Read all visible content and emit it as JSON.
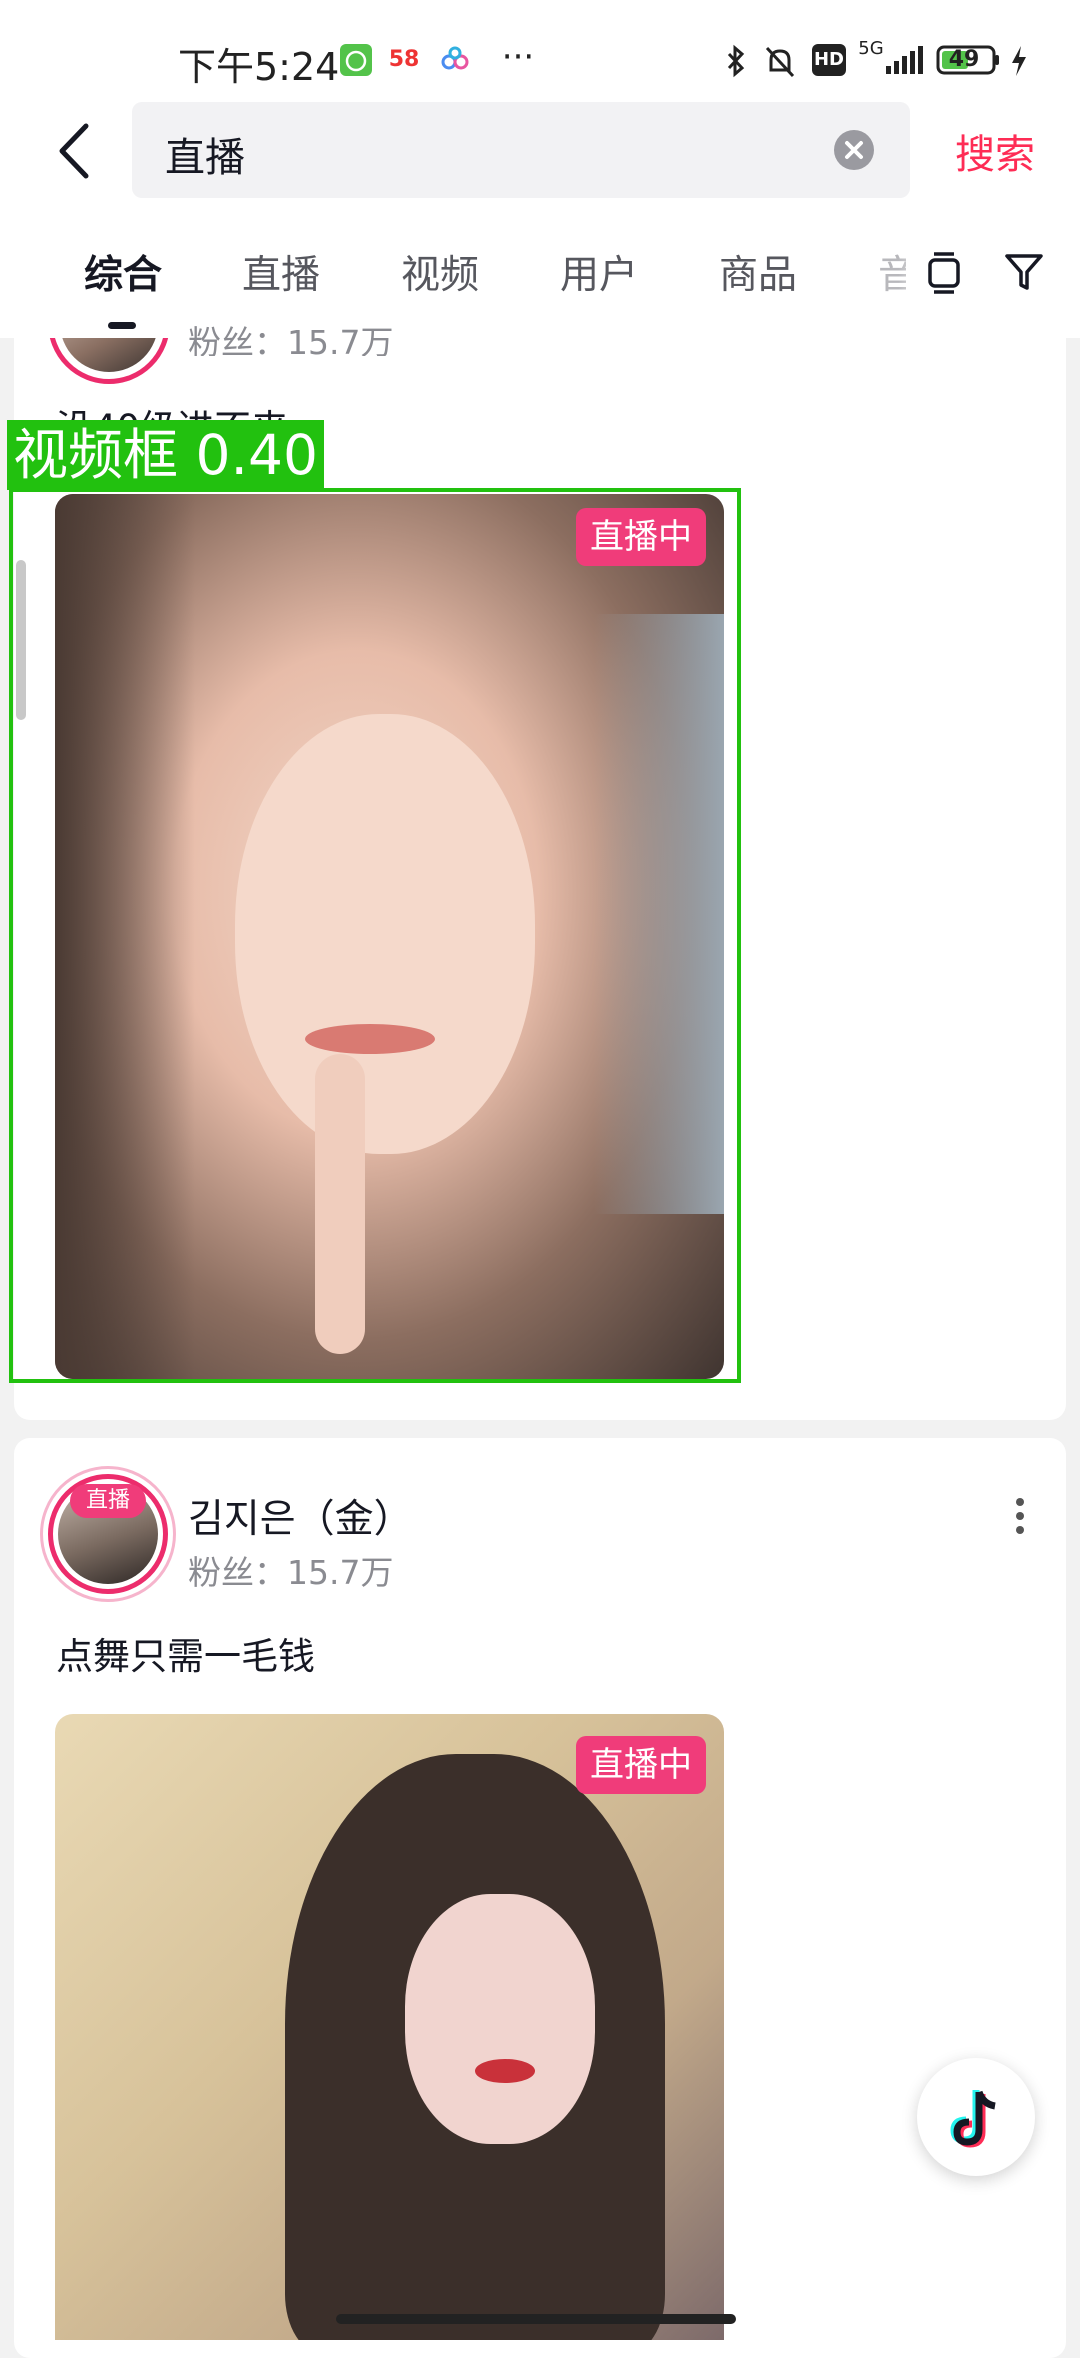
{
  "status_bar": {
    "time": "下午5:24",
    "network": "5G",
    "battery": "49",
    "hd": "HD",
    "app58": "58",
    "more": "···"
  },
  "search": {
    "query": "直播",
    "search_button": "搜索"
  },
  "tabs": [
    {
      "label": "综合",
      "active": true
    },
    {
      "label": "直播",
      "active": false
    },
    {
      "label": "视频",
      "active": false
    },
    {
      "label": "用户",
      "active": false
    },
    {
      "label": "商品",
      "active": false
    },
    {
      "label": "音",
      "active": false
    }
  ],
  "results": [
    {
      "fans": "粉丝：15.7万",
      "caption": "没40级进不来",
      "live_badge": "直播中"
    },
    {
      "username": "김지은（金）",
      "fans": "粉丝：15.7万",
      "caption": "点舞只需一毛钱",
      "live_badge": "直播中",
      "avatar_badge": "直播"
    }
  ],
  "detection": {
    "label": "视频框 0.40"
  },
  "colors": {
    "accent": "#fe2c55",
    "live_badge": "#f03c7a",
    "detection": "#22c10f"
  }
}
